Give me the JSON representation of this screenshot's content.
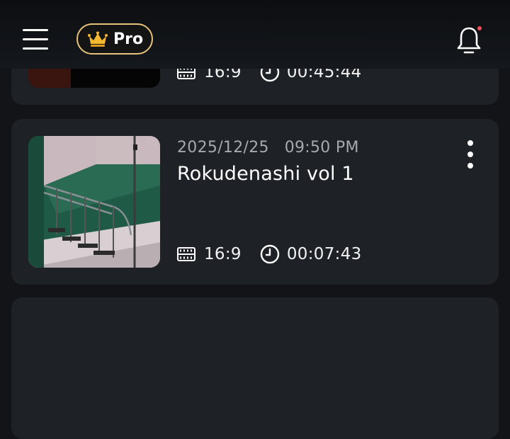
{
  "header": {
    "pro_label": "Pro",
    "colors": {
      "accent_gold": "#e7c27a",
      "notification_dot": "#f04e5a"
    }
  },
  "videos": [
    {
      "aspect_ratio": "16:9",
      "duration": "00:45:44"
    },
    {
      "date": "2025/12/25",
      "time": "09:50 PM",
      "title": "Rokudenashi vol 1",
      "aspect_ratio": "16:9",
      "duration": "00:07:43"
    }
  ],
  "icons": [
    "menu-icon",
    "crown-icon",
    "bell-icon",
    "film-icon",
    "clock-icon",
    "more-vertical-icon"
  ]
}
